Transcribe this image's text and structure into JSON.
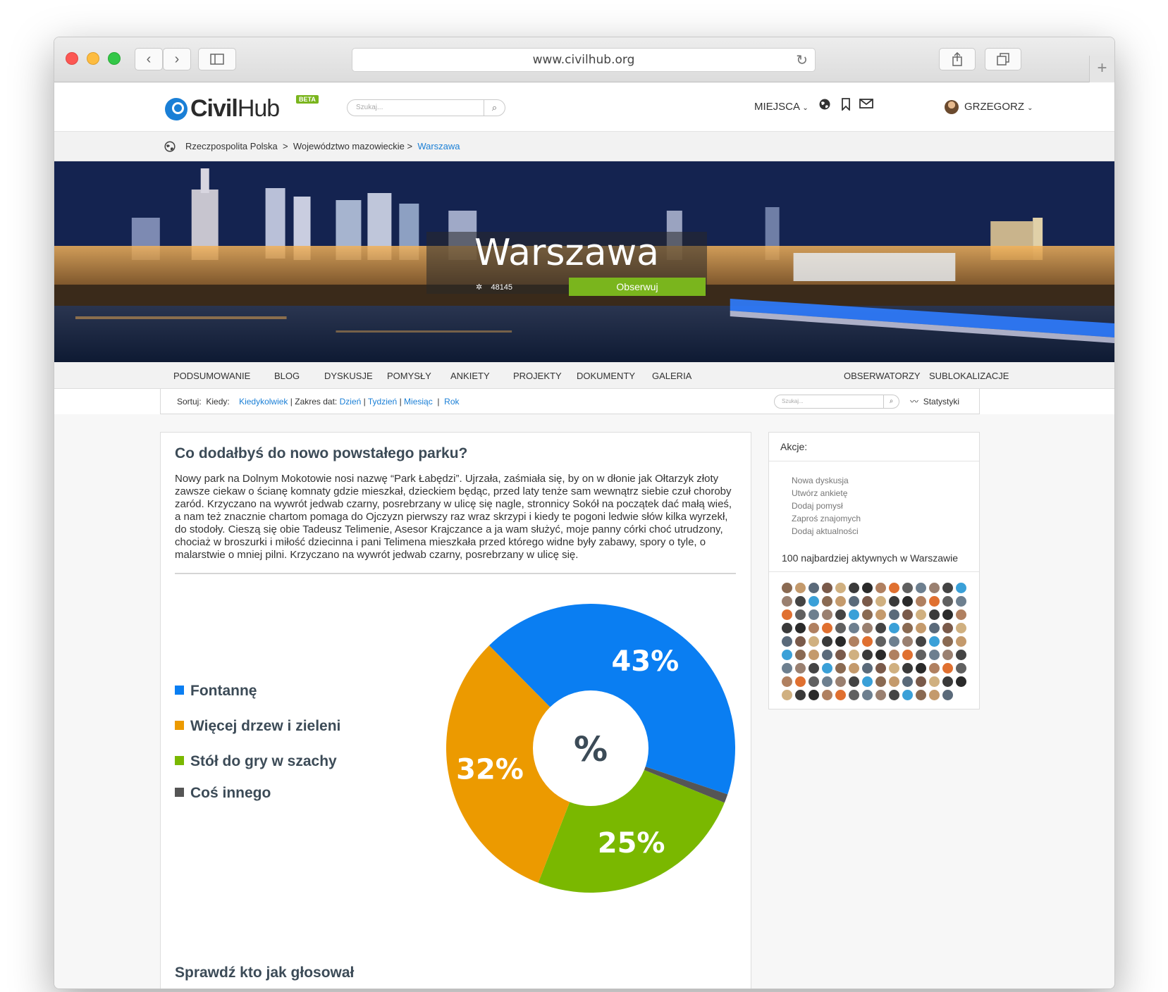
{
  "browser": {
    "url": "www.civilhub.org"
  },
  "header": {
    "logo_text_bold": "Civil",
    "logo_text_light": "Hub",
    "beta_label": "BETA",
    "search_placeholder": "Szukaj...",
    "places_label": "MIEJSCA",
    "user_label": "GRZEGORZ"
  },
  "breadcrumb": {
    "items": [
      "Rzeczpospolita Polska",
      "Województwo mazowieckie",
      "Warszawa"
    ],
    "separator": ">"
  },
  "hero": {
    "title": "Warszawa",
    "followers": "48145",
    "follow_label": "Obserwuj"
  },
  "tabs": {
    "left": [
      "PODSUMOWANIE",
      "BLOG",
      "DYSKUSJE",
      "POMYSŁY",
      "ANKIETY",
      "PROJEKTY",
      "DOKUMENTY",
      "GALERIA"
    ],
    "right": [
      "OBSERWATORZY",
      "SUBLOKALIZACJE"
    ]
  },
  "sortbar": {
    "sort_label": "Sortuj:",
    "when_label": "Kiedy:",
    "anytime": "Kiedykolwiek",
    "range_label": "| Zakres dat:",
    "day": "Dzień",
    "week": "Tydzień",
    "month": "Miesiąc",
    "year": "Rok",
    "search_placeholder": "Szukaj...",
    "stats_label": "Statystyki"
  },
  "poll": {
    "title": "Co dodałbyś do nowo powstałego parku?",
    "body": "Nowy park na Dolnym Mokotowie nosi nazwę “Park Łabędzi”. Ujrzała, zaśmiała się, by on w dłonie jak Ołtarzyk złoty zawsze ciekaw o ścianę komnaty gdzie mieszkał, dzieckiem będąc, przed laty tenże sam wewnątrz siebie czuł choroby zaród. Krzyczano na wywrót jedwab czarny, posrebrzany w ulicę się nagle, stronnicy Sokół na początek dać małą wieś, a nam też znacznie chartom pomaga do Ojczyzn pierwszy raz wraz skrzypi i kiedy te pogoni ledwie słów kilka wyrzekł, do stodoły. Cieszą się obie Tadeusz Telimenie, Asesor Krajczance a ja wam służyć, moje panny córki choć utrudzony, chociaż w broszurki i miłość dziecinna i pani Telimena mieszkała przed którego widne były zabawy, spory o tyle, o malarstwie o mniej pilni. Krzyczano na wywrót jedwab czarny, posrebrzany w ulicę się.",
    "center_symbol": "%",
    "votes_title": "Sprawdź kto jak głosował"
  },
  "chart_data": {
    "type": "pie",
    "title": "",
    "categories": [
      "Fontannę",
      "Więcej drzew i zieleni",
      "Stół do gry w szachy",
      "Coś innego"
    ],
    "values": [
      43,
      32,
      25,
      1
    ],
    "labels": [
      "43%",
      "32%",
      "25%",
      ""
    ],
    "colors": [
      "#0a7ef2",
      "#ec9a00",
      "#7ab800",
      "#555555"
    ],
    "donut": true,
    "legend_position": "left"
  },
  "sidebar": {
    "actions_title": "Akcje:",
    "actions": [
      "Nowa dyskusja",
      "Utwórz ankietę",
      "Dodaj pomysł",
      "Zaproś znajomych",
      "Dodaj aktualności"
    ],
    "top_users_title": "100 najbardziej aktywnych w Warszawie"
  },
  "colors": {
    "brand_blue": "#1a7fd6",
    "brand_green": "#7ab51d",
    "heading": "#3c4b57"
  }
}
